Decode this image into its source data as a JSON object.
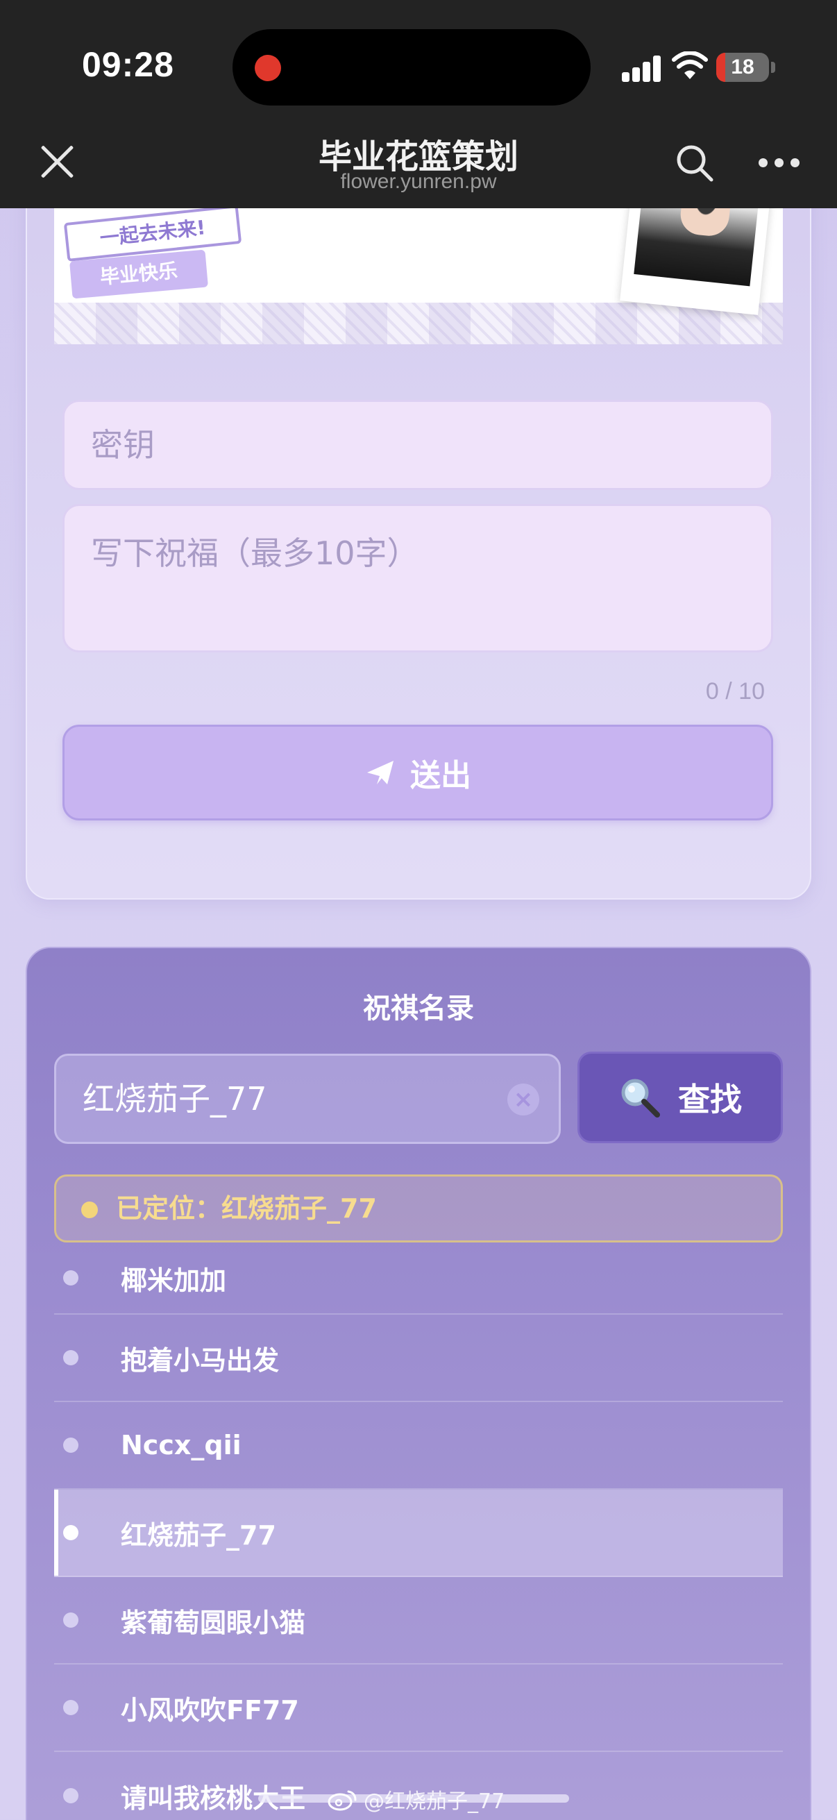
{
  "status_bar": {
    "time": "09:28",
    "battery": "18"
  },
  "nav": {
    "title": "毕业花篮策划",
    "subtitle": "flower.yunren.pw"
  },
  "banner": {
    "sticker_1": "一起去未来!",
    "sticker_2": "毕业快乐"
  },
  "form": {
    "key_placeholder": "密钥",
    "wish_placeholder": "写下祝福（最多10字）",
    "char_count": "0 / 10",
    "send_label": "送出"
  },
  "list": {
    "title": "祝祺名录",
    "search_value": "红烧茄子_77",
    "clear_symbol": "×",
    "find_label": "查找",
    "located_text": "已定位：红烧茄子_77",
    "names": [
      "椰米加加",
      "抱着小马出发",
      "Nccx_qii",
      "红烧茄子_77",
      "紫葡萄圆眼小猫",
      "小风吹吹FF77",
      "请叫我核桃大王"
    ],
    "active_index": 3
  },
  "watermark": "@红烧茄子_77",
  "colors": {
    "accent": "#6a56b6",
    "send_button": "#c8b4f1",
    "located_text": "#f7dc8f",
    "recording_dot": "#e0382c"
  }
}
